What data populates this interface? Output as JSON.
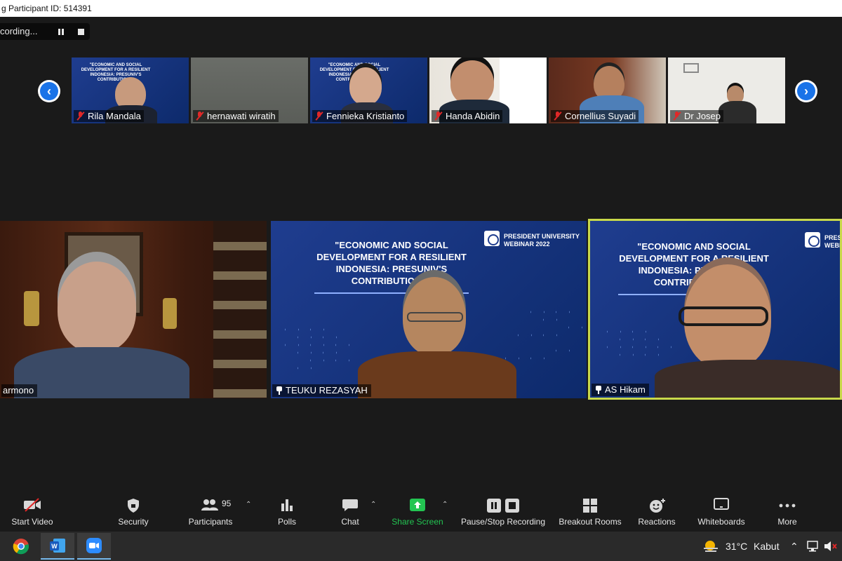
{
  "window": {
    "title": "g Participant ID: 514391"
  },
  "recording": {
    "status": "cording..."
  },
  "slide": {
    "title": "\"ECONOMIC AND SOCIAL DEVELOPMENT FOR A RESILIENT INDONESIA: PRESUNIV'S CONTRIBUTIONS\"",
    "lines": [
      "\"ECONOMIC AND SOCIAL",
      "DEVELOPMENT FOR A RESILIENT",
      "INDONESIA: PRESUNIV'S",
      "CONTRIBUTIONS\""
    ],
    "mini_lines": [
      "\"ECONOMIC AND SOCIAL",
      "DEVELOPMENT FOR A RESILIENT",
      "INDONESIA: PRESUNIV'S",
      "CONTRIBUTIONS\""
    ],
    "brand_line1": "PRESIDENT UNIVERSITY",
    "brand_line2": "WEBINAR 2022",
    "brand_short": "PRESIDENT UNIVERSITY WEBINAR 2022"
  },
  "gallery": [
    {
      "name": "Rila Mandala"
    },
    {
      "name": "hernawati wiratih"
    },
    {
      "name": "Fennieka Kristianto"
    },
    {
      "name": "Handa Abidin"
    },
    {
      "name": "Cornellius Suyadi"
    },
    {
      "name": "Dr Josep"
    }
  ],
  "main": [
    {
      "name": "armono"
    },
    {
      "name": "TEUKU REZASYAH"
    },
    {
      "name": "AS Hikam"
    }
  ],
  "toolbar": {
    "start_video": "Start Video",
    "security": "Security",
    "participants": "Participants",
    "participants_count": "95",
    "polls": "Polls",
    "chat": "Chat",
    "share_screen": "Share Screen",
    "pause_stop_recording": "Pause/Stop Recording",
    "breakout_rooms": "Breakout Rooms",
    "reactions": "Reactions",
    "whiteboards": "Whiteboards",
    "more": "More"
  },
  "taskbar": {
    "weather_temp": "31°C",
    "weather_desc": "Kabut"
  },
  "colors": {
    "accent_blue": "#1a73e8",
    "share_green": "#23c552",
    "active_speaker": "#c9d94a",
    "muted_red": "#e02828"
  }
}
